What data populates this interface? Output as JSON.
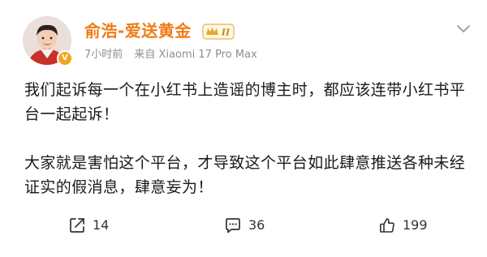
{
  "user": {
    "name": "俞浩-爱送黄金",
    "level_badge": "II",
    "verified_mark": "V",
    "time": "7小时前",
    "source": "来自 Xiaomi 17 Pro Max"
  },
  "post": {
    "paragraphs": [
      "我们起诉每一个在小红书上造谣的博主时，都应该连带小红书平台一起起诉！",
      "大家就是害怕这个平台，才导致这个平台如此肆意推送各种未经证实的假消息，肆意妄为！"
    ]
  },
  "actions": {
    "share_count": "14",
    "comment_count": "36",
    "like_count": "199"
  },
  "icons": {
    "share": "share-icon",
    "comment": "comment-icon",
    "like": "thumbs-up-icon",
    "more": "chevron-down-icon"
  },
  "colors": {
    "username": "#f07b16",
    "meta": "#8e8e8e",
    "verified": "#f2a51b"
  }
}
